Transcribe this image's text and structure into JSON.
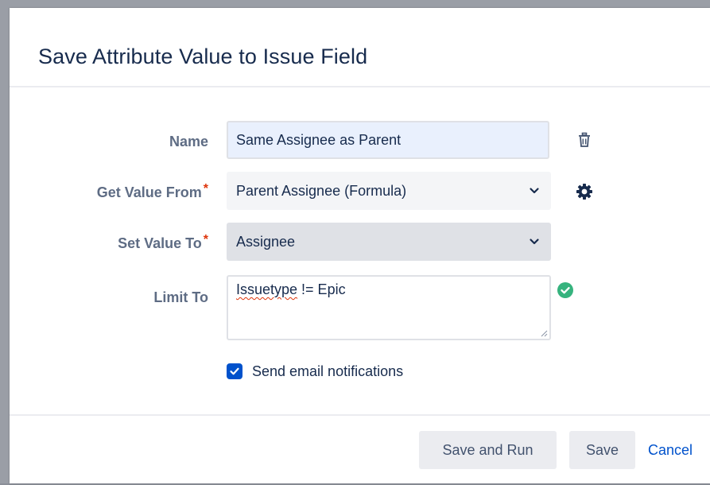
{
  "dialog": {
    "title": "Save Attribute Value to Issue Field"
  },
  "form": {
    "name": {
      "label": "Name",
      "value": "Same Assignee as Parent"
    },
    "get_value_from": {
      "label": "Get Value From",
      "required_mark": "*",
      "selected": "Parent Assignee (Formula)"
    },
    "set_value_to": {
      "label": "Set Value To",
      "required_mark": "*",
      "selected": "Assignee"
    },
    "limit_to": {
      "label": "Limit To",
      "value_word1": "Issuetype",
      "value_rest": " != Epic"
    },
    "send_email": {
      "label": "Send email notifications",
      "checked": true
    }
  },
  "footer": {
    "save_and_run_label": "Save and Run",
    "save_label": "Save",
    "cancel_label": "Cancel"
  },
  "colors": {
    "accent": "#0052cc",
    "success": "#36b37e",
    "required": "#de350b"
  },
  "icons": {
    "delete": "trash-icon",
    "settings": "gear-icon",
    "valid": "check-circle-icon",
    "dropdown": "chevron-down-icon"
  }
}
